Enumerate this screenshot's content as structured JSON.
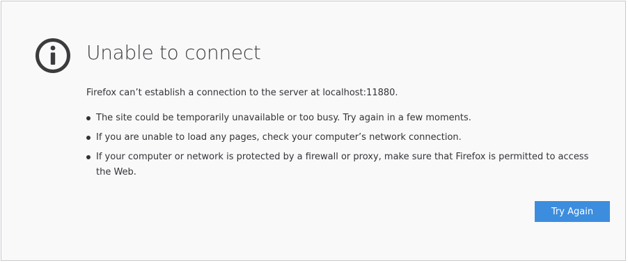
{
  "error": {
    "icon": "info-icon",
    "title": "Unable to connect",
    "description": "Firefox can’t establish a connection to the server at localhost:11880.",
    "bullets": [
      "The site could be temporarily unavailable or too busy. Try again in a few moments.",
      "If you are unable to load any pages, check your computer’s network connection.",
      "If your computer or network is protected by a firewall or proxy, make sure that Firefox is permitted to access the Web."
    ],
    "retry_label": "Try Again"
  },
  "colors": {
    "background": "#f9f9fa",
    "text": "#333336",
    "icon": "#3c3c3f",
    "button": "#3c8dde",
    "button_text": "#ffffff"
  }
}
